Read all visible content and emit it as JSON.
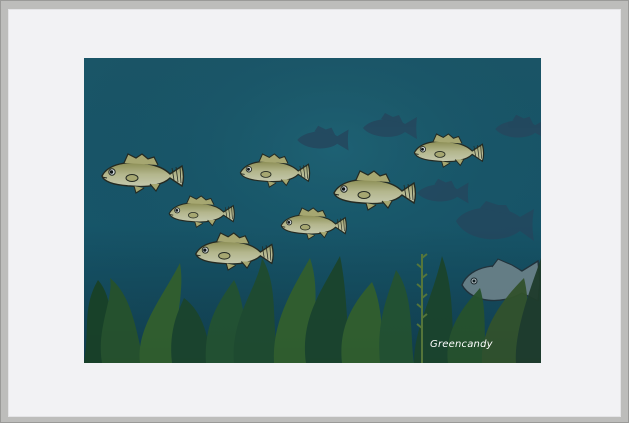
{
  "image": {
    "description_colors": {
      "water_top": "#1e5f73",
      "water_bottom": "#134a5e",
      "fish_body": "#d8d49a",
      "fish_outline": "#2a2a1e",
      "shadow_fish": "#2a4e66",
      "seaweed_dark": "#1f4a2a",
      "seaweed_light": "#3f6a2c",
      "mat": "#f2f2f4",
      "frame": "#bdbdbb"
    },
    "signature": "Greencandy"
  }
}
